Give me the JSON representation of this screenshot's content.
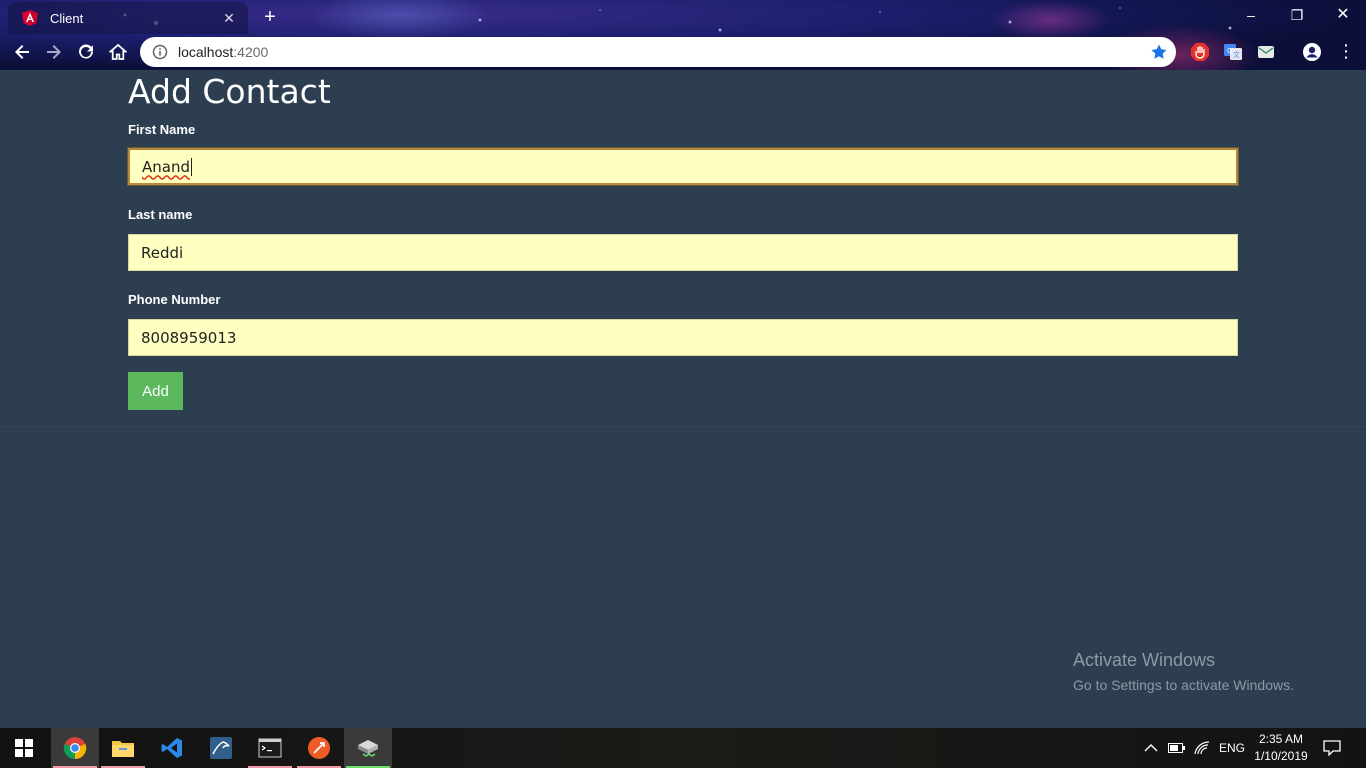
{
  "browser": {
    "tab_title": "Client",
    "url_host": "localhost",
    "url_port": ":4200",
    "icons": {
      "tab": "angular-icon",
      "close": "close-icon",
      "new_tab": "plus-icon",
      "back": "back-arrow-icon",
      "forward": "forward-arrow-icon",
      "reload": "reload-icon",
      "home": "home-icon",
      "info": "info-icon",
      "star": "star-icon",
      "extensions": [
        "adblock-icon",
        "translate-icon",
        "mail-icon"
      ],
      "profile": "profile-icon",
      "menu": "menu-dots-icon"
    },
    "window_controls": {
      "minimize": "–",
      "maximize": "❐",
      "close": "✕"
    }
  },
  "form": {
    "title": "Add Contact",
    "first_name": {
      "label": "First Name",
      "value": "Anand"
    },
    "last_name": {
      "label": "Last name",
      "value": "Reddi"
    },
    "phone": {
      "label": "Phone Number",
      "value": "8008959013"
    },
    "submit_label": "Add"
  },
  "watermark": {
    "line1": "Activate Windows",
    "line2": "Go to Settings to activate Windows."
  },
  "taskbar": {
    "apps": [
      "windows-start-icon",
      "chrome-icon",
      "file-explorer-icon",
      "vscode-icon",
      "mysql-workbench-icon",
      "terminal-icon",
      "postman-icon",
      "server-icon"
    ],
    "language": "ENG",
    "time": "2:35 AM",
    "date": "1/10/2019"
  },
  "colors": {
    "page_bg": "#2c3e50",
    "input_bg": "#ffffc2",
    "button_green": "#5cb85c"
  }
}
